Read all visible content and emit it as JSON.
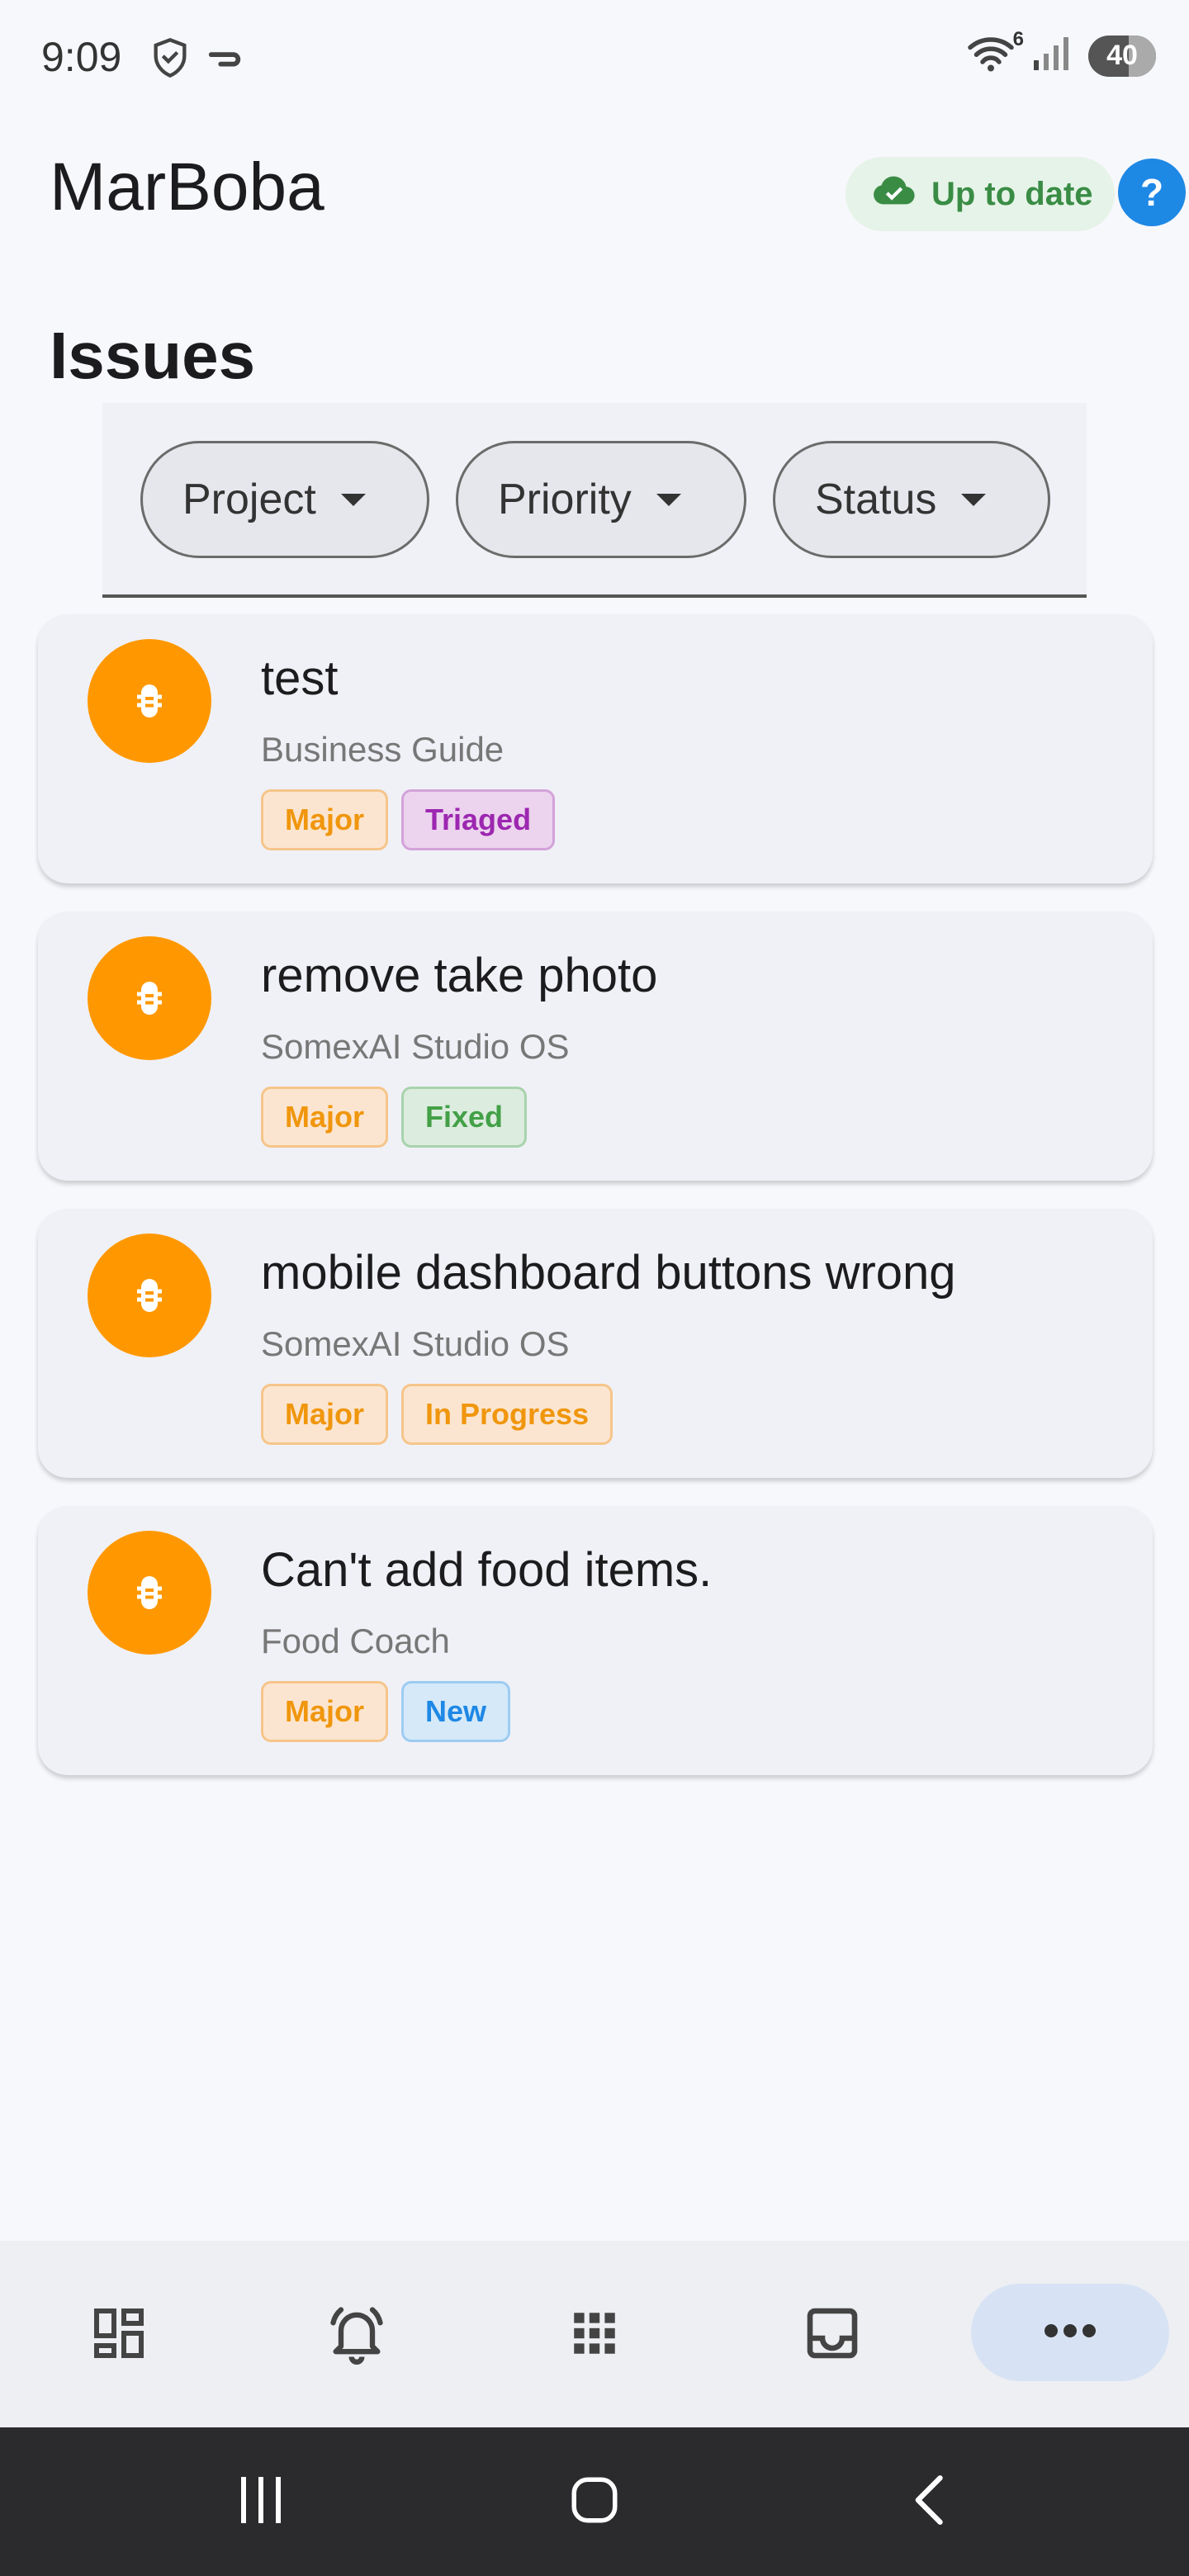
{
  "status_bar": {
    "time": "9:09",
    "wifi_badge": "6",
    "battery": "40"
  },
  "header": {
    "app_title": "MarBoba",
    "sync_status": "Up to date",
    "help_label": "?"
  },
  "section_title": "Issues",
  "filters": [
    {
      "label": "Project"
    },
    {
      "label": "Priority"
    },
    {
      "label": "Status"
    }
  ],
  "issues": [
    {
      "title": "test",
      "project": "Business Guide",
      "priority": "Major",
      "status": "Triaged"
    },
    {
      "title": "remove take photo",
      "project": "SomexAI Studio OS",
      "priority": "Major",
      "status": "Fixed"
    },
    {
      "title": "mobile dashboard buttons wrong",
      "project": "SomexAI Studio OS",
      "priority": "Major",
      "status": "In Progress"
    },
    {
      "title": "Can't add food items.",
      "project": "Food Coach",
      "priority": "Major",
      "status": "New"
    }
  ],
  "bottom_nav": {
    "items": [
      "dashboard-icon",
      "notifications-icon",
      "apps-grid-icon",
      "inbox-icon",
      "more-icon"
    ]
  },
  "colors": {
    "accent_blue": "#1e88e5",
    "bug_orange": "#ff9800",
    "sync_green": "#3a8c45"
  }
}
